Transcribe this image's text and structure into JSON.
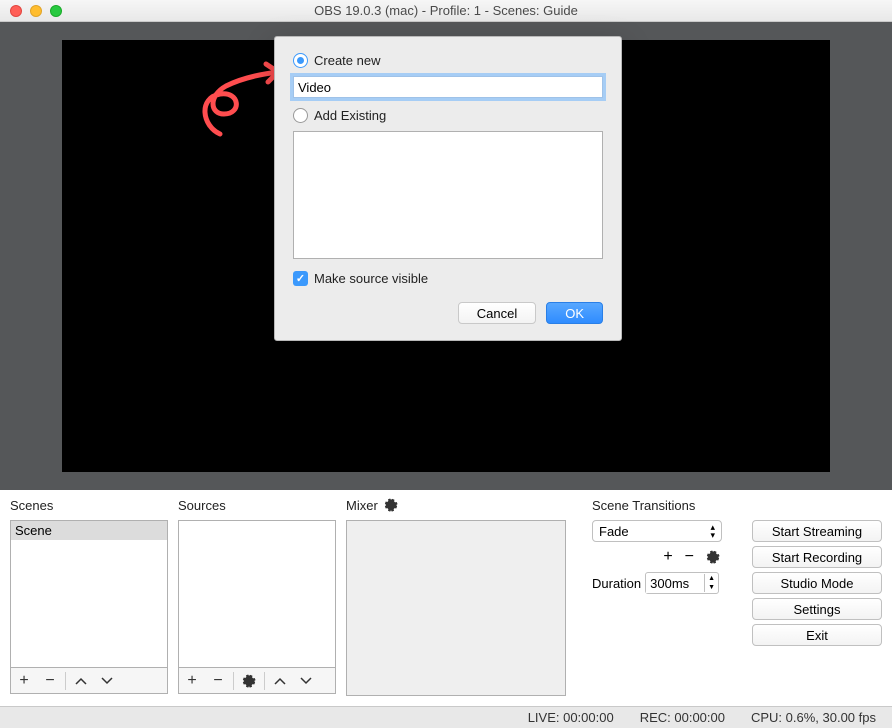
{
  "window_title": "OBS 19.0.3 (mac) - Profile: 1 - Scenes: Guide",
  "dialog": {
    "create_new_label": "Create new",
    "input_value": "Video",
    "add_existing_label": "Add Existing",
    "make_visible_label": "Make source visible",
    "cancel": "Cancel",
    "ok": "OK"
  },
  "panels": {
    "scenes_title": "Scenes",
    "sources_title": "Sources",
    "mixer_title": "Mixer",
    "transitions_title": "Scene Transitions",
    "scene_item": "Scene"
  },
  "transitions": {
    "selected": "Fade",
    "duration_label": "Duration",
    "duration_value": "300ms"
  },
  "controls": {
    "start_streaming": "Start Streaming",
    "start_recording": "Start Recording",
    "studio_mode": "Studio Mode",
    "settings": "Settings",
    "exit": "Exit"
  },
  "status": {
    "live": "LIVE: 00:00:00",
    "rec": "REC: 00:00:00",
    "cpu": "CPU: 0.6%, 30.00 fps"
  }
}
